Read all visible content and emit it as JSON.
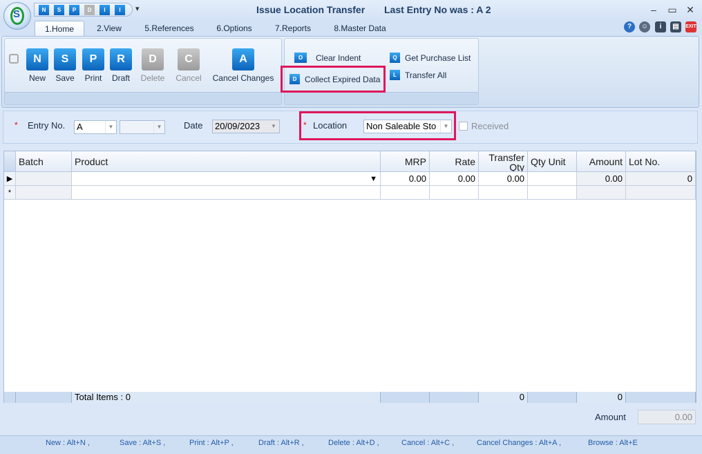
{
  "window": {
    "title": "Issue Location Transfer",
    "last_entry": "Last Entry No was : A 2",
    "minimize": "–",
    "restore": "▭",
    "close": "✕"
  },
  "quick_access": [
    "N",
    "S",
    "P",
    "D",
    "I",
    "I"
  ],
  "quick_access_more": "▾",
  "tabs": [
    "1.Home",
    "2.View",
    "5.References",
    "6.Options",
    "7.Reports",
    "8.Master Data"
  ],
  "ribbon": {
    "main": [
      {
        "label": "New",
        "glyph": "N",
        "enabled": true
      },
      {
        "label": "Save",
        "glyph": "S",
        "enabled": true
      },
      {
        "label": "Print",
        "glyph": "P",
        "enabled": true
      },
      {
        "label": "Draft",
        "glyph": "R",
        "enabled": true
      },
      {
        "label": "Delete",
        "glyph": "D",
        "enabled": false
      },
      {
        "label": "Cancel",
        "glyph": "C",
        "enabled": false
      },
      {
        "label": "Cancel Changes",
        "glyph": "A",
        "enabled": true
      }
    ],
    "clear_indent": "Clear Indent",
    "collect_expired": "Collect Expired Data",
    "get_purchase_list": "Get Purchase List",
    "transfer_all": "Transfer All",
    "clear_indent_glyph": "O",
    "collect_expired_glyph": "D",
    "get_purchase_glyph": "Q",
    "transfer_all_glyph": "L"
  },
  "form": {
    "entry_no_label": "Entry No.",
    "entry_no_value": "A",
    "date_label": "Date",
    "date_value": "20/09/2023",
    "location_label": "Location",
    "location_value": "Non Saleable Sto",
    "received_label": "Received",
    "required_mark": "*"
  },
  "grid": {
    "columns": [
      "Batch",
      "Product",
      "MRP",
      "Rate",
      "Transfer Qty",
      "Qty Unit",
      "Amount",
      "Lot No."
    ],
    "row1": {
      "mrp": "0.00",
      "rate": "0.00",
      "transfer_qty": "0.00",
      "amount": "0.00",
      "lot_no": "0"
    },
    "new_row_marker": "*",
    "current_row_marker": "▶",
    "totals": {
      "label": "Total Items : 0",
      "transfer_qty": "0",
      "amount": "0"
    }
  },
  "amount": {
    "label": "Amount",
    "value": "0.00"
  },
  "shortcuts": [
    "New : Alt+N ,",
    "Save : Alt+S ,",
    "Print : Alt+P ,",
    "Draft : Alt+R ,",
    "Delete : Alt+D ,",
    "Cancel : Alt+C ,",
    "Cancel Changes : Alt+A ,",
    "Browse : Alt+E"
  ]
}
